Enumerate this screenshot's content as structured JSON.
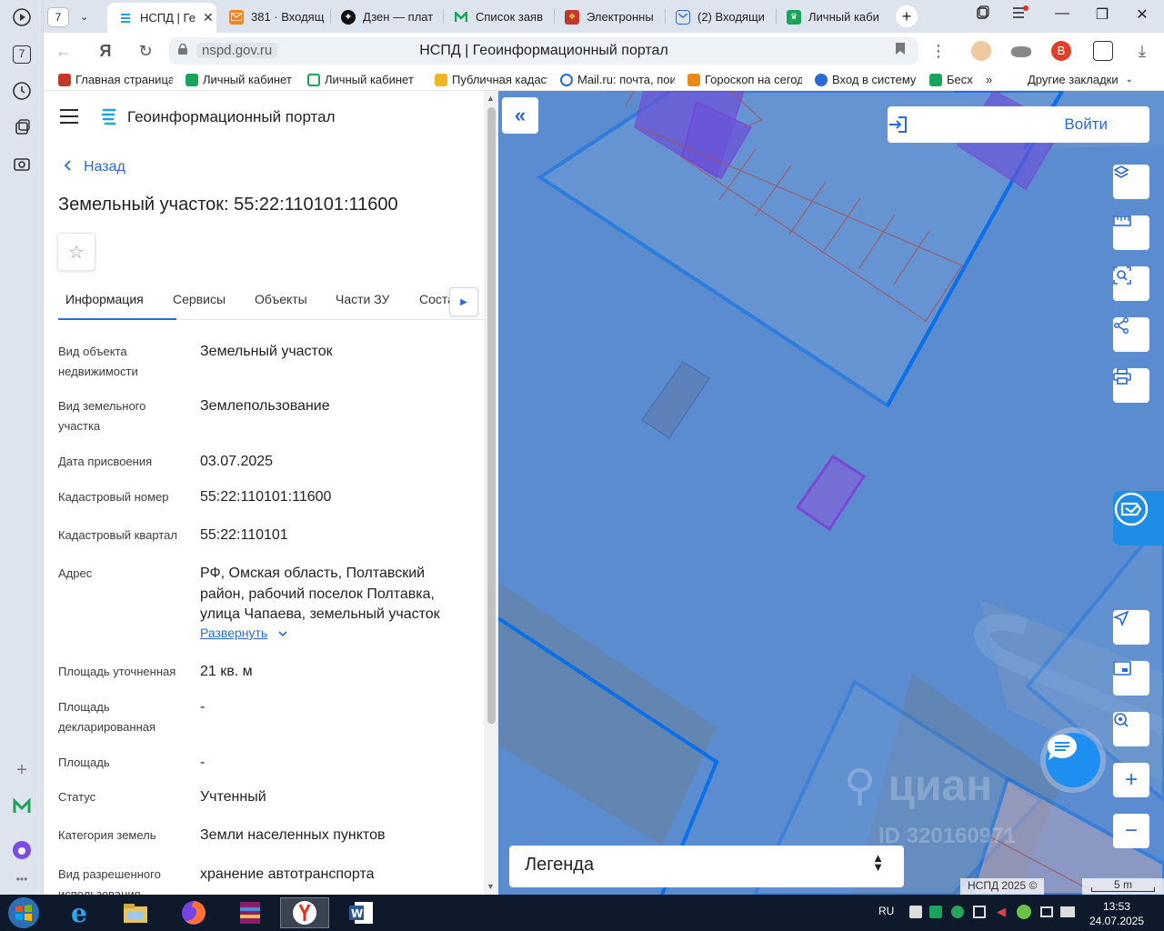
{
  "browser": {
    "left_strip": {
      "counter": "7"
    },
    "tab_counter": "7",
    "tabs": [
      {
        "label": "НСПД | Ге",
        "active": true
      },
      {
        "label": "381 · Входящ"
      },
      {
        "label": "Дзен — плат"
      },
      {
        "label": "Список заяв"
      },
      {
        "label": "Электронны"
      },
      {
        "label": "(2) Входящи"
      },
      {
        "label": "Личный каби"
      }
    ],
    "new_tab": "+",
    "address": {
      "host": "nspd.gov.ru",
      "title": "НСПД | Геоинформационный портал"
    },
    "bookmarks": [
      "Главная страница",
      "Личный кабинет",
      "Личный кабинет",
      "Публичная кадаст",
      "Mail.ru: почта, пои",
      "Гороскоп на сегод",
      "Вход в систему",
      "Бесх",
      "»",
      "Другие закладки"
    ]
  },
  "panel": {
    "portal_title": "Геоинформационный портал",
    "back_label": "Назад",
    "object_title": "Земельный участок: 55:22:110101:11600",
    "tabs": [
      "Информация",
      "Сервисы",
      "Объекты",
      "Части ЗУ",
      "Соста"
    ],
    "rows": [
      {
        "label": "Вид объекта недвижимости",
        "value": "Земельный участок"
      },
      {
        "label": "Вид земельного участка",
        "value": "Землепользование"
      },
      {
        "label": "Дата присвоения",
        "value": "03.07.2025"
      },
      {
        "label": "Кадастровый номер",
        "value": "55:22:110101:11600"
      },
      {
        "label": "Кадастровый квартал",
        "value": "55:22:110101"
      },
      {
        "label": "Адрес",
        "value": "РФ, Омская область, Полтавский район, рабочий поселок Полтавка, улица Чапаева, земельный участок"
      },
      {
        "label": "Площадь уточненная",
        "value": "21 кв. м"
      },
      {
        "label": "Площадь декларированная",
        "value": "-"
      },
      {
        "label": "Площадь",
        "value": "-"
      },
      {
        "label": "Статус",
        "value": "Учтенный"
      },
      {
        "label": "Категория земель",
        "value": "Земли населенных пунктов"
      },
      {
        "label": "Вид разрешенного использования",
        "value": "хранение автотранспорта"
      }
    ],
    "expand_label": "Развернуть"
  },
  "map": {
    "login_label": "Войти",
    "legend_label": "Легенда",
    "watermark": "циан",
    "watermark_id": "ID 320160971",
    "copyright": "НСПД 2025 ©",
    "scale_label": "5 m"
  },
  "taskbar": {
    "lang": "RU",
    "time": "13:53",
    "date": "24.07.2025"
  },
  "colors": {
    "accent": "#2a6ad4",
    "map_bg": "#5b8ccf",
    "parcel_border": "#0a6fe8",
    "selected_parcel": "#7b3fd6"
  }
}
